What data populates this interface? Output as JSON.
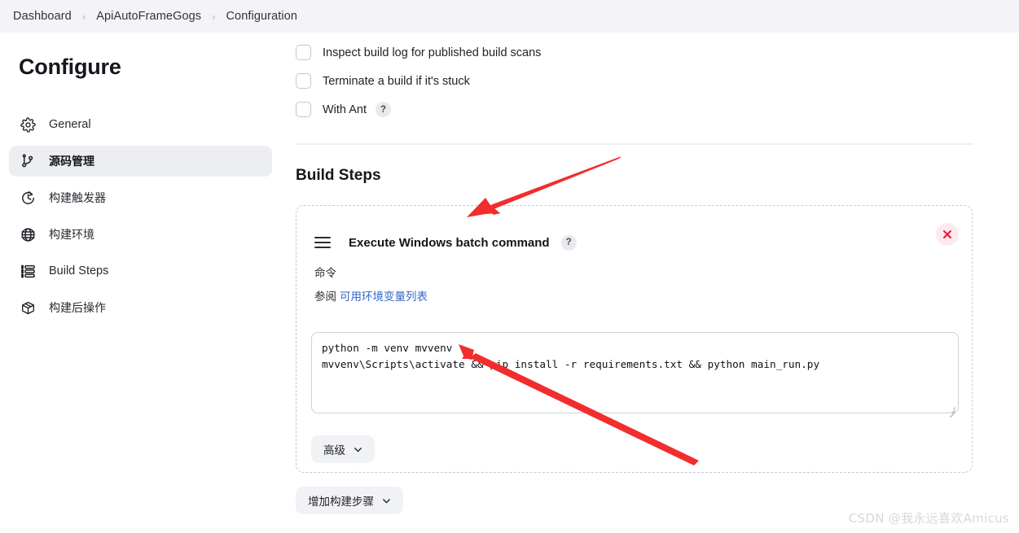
{
  "breadcrumb": {
    "separator": "›",
    "items": [
      {
        "label": "Dashboard"
      },
      {
        "label": "ApiAutoFrameGogs"
      },
      {
        "label": "Configuration"
      }
    ]
  },
  "sidebar": {
    "title": "Configure",
    "items": [
      {
        "label": "General",
        "icon": "gear-icon",
        "active": false
      },
      {
        "label": "源码管理",
        "icon": "git-branch-icon",
        "active": true
      },
      {
        "label": "构建触发器",
        "icon": "clock-icon",
        "active": false
      },
      {
        "label": "构建环境",
        "icon": "globe-icon",
        "active": false
      },
      {
        "label": "Build Steps",
        "icon": "list-icon",
        "active": false
      },
      {
        "label": "构建后操作",
        "icon": "package-icon",
        "active": false
      }
    ]
  },
  "main": {
    "checkboxes": [
      {
        "label": "Inspect build log for published build scans",
        "checked": false,
        "help": null
      },
      {
        "label": "Terminate a build if it's stuck",
        "checked": false,
        "help": null
      },
      {
        "label": "With Ant",
        "checked": false,
        "help": "?"
      }
    ],
    "section_title": "Build Steps",
    "build_step": {
      "title": "Execute Windows batch command",
      "help": "?",
      "drag_handle": "drag-handle-icon",
      "delete_label": "×",
      "command_label": "命令",
      "reference_prefix": "参阅",
      "reference_link": "可用环境变量列表",
      "command_value": "python -m venv mvvenv\nmvvenv\\Scripts\\activate && pip install -r requirements.txt && python main_run.py",
      "command_placeholder": "",
      "advanced_label": "高级"
    },
    "add_step_label": "增加构建步骤"
  },
  "watermark": "CSDN @我永远喜欢Amicus",
  "colors": {
    "breadcrumb_bg": "#f4f4f6",
    "active_nav_bg": "#eceef2",
    "link": "#3569c9",
    "annotation_red": "#f22d2d",
    "delete_red": "#e8193a",
    "delete_bg": "#fdeaee",
    "text": "#22222a"
  }
}
